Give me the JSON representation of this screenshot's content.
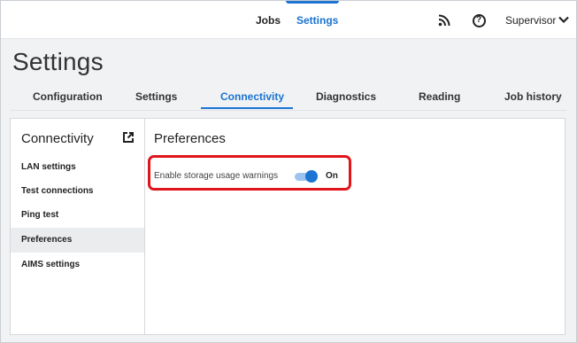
{
  "header": {
    "nav": [
      {
        "label": "Jobs"
      },
      {
        "label": "Settings"
      }
    ],
    "user_label": "Supervisor",
    "icons": {
      "feed": "rss-icon",
      "help": "help-icon",
      "user_menu": "chevron-down-icon"
    },
    "help_glyph": "?",
    "accent_color": "#1c75d3"
  },
  "page_title": "Settings",
  "tabs": [
    {
      "label": "Configuration"
    },
    {
      "label": "Settings"
    },
    {
      "label": "Connectivity"
    },
    {
      "label": "Diagnostics"
    },
    {
      "label": "Reading"
    },
    {
      "label": "Job history"
    }
  ],
  "active_tab": "Connectivity",
  "sidebar": {
    "title": "Connectivity",
    "open_icon": "external-link-icon",
    "items": [
      {
        "label": "LAN settings"
      },
      {
        "label": "Test connections"
      },
      {
        "label": "Ping test"
      },
      {
        "label": "Preferences"
      },
      {
        "label": "AIMS settings"
      }
    ],
    "selected": "Preferences"
  },
  "main": {
    "title": "Preferences",
    "setting": {
      "label": "Enable storage usage warnings",
      "state_label": "On",
      "enabled": true
    },
    "highlight_color": "#e0151c"
  }
}
